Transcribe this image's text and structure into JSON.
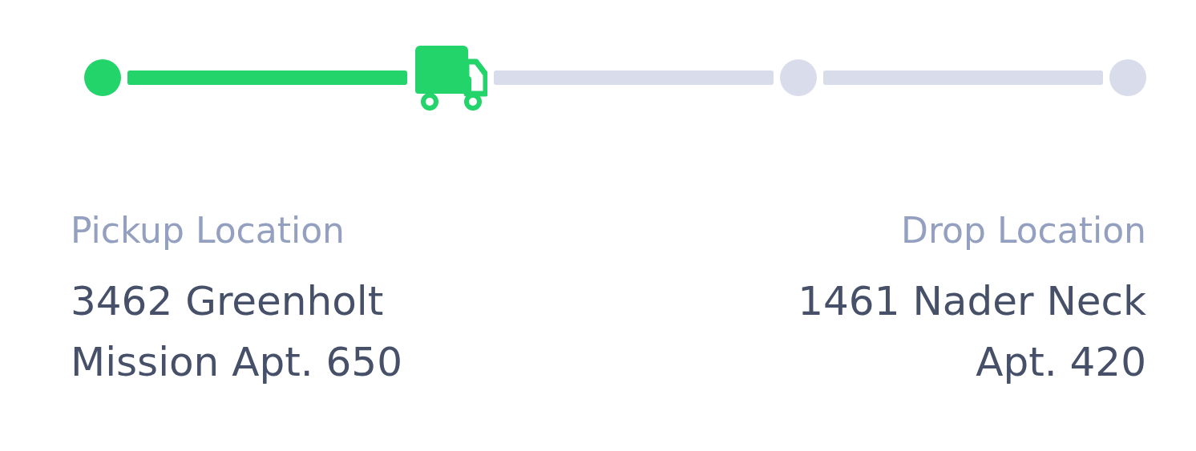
{
  "progress": {
    "stops": [
      {
        "kind": "dot",
        "reached": true
      },
      {
        "kind": "truck",
        "reached": true
      },
      {
        "kind": "dot",
        "reached": false
      },
      {
        "kind": "dot",
        "reached": false
      }
    ]
  },
  "locations": [
    {
      "label": "Pickup Location",
      "address": "3462 Greenholt Mission Apt. 650"
    },
    {
      "label": "Drop Location",
      "address": "1461 Nader Neck Apt. 420"
    }
  ]
}
